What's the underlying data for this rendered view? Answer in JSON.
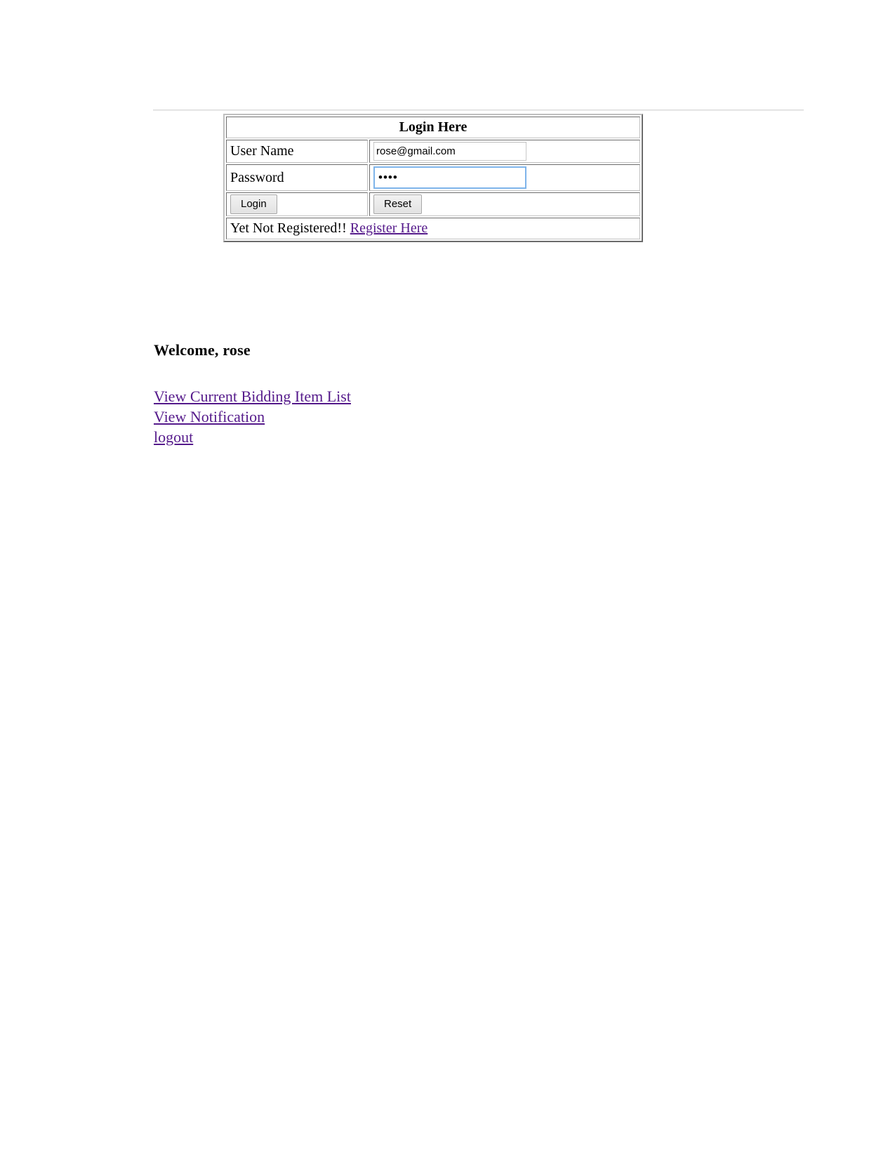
{
  "page": {
    "background_color": "#ffffff",
    "text_color": "#000000",
    "link_color": "#551a8b"
  },
  "divider": {
    "name": "horizontal-rule",
    "color": "#d9d9d9"
  },
  "login_form": {
    "title": "Login Here",
    "rows": {
      "username": {
        "label": "User Name",
        "value": "rose@gmail.com",
        "placeholder": "",
        "type": "text",
        "focused": false
      },
      "password": {
        "label": "Password",
        "value": "••••",
        "masked_value": "••••",
        "placeholder": "",
        "type": "password",
        "focused": true,
        "focus_ring_color": "#7eb4ea"
      }
    },
    "buttons": {
      "submit_label": "Login",
      "reset_label": "Reset"
    },
    "register": {
      "prompt": "Yet Not Registered!!",
      "link_label": "Register Here"
    }
  },
  "account": {
    "welcome_heading": "Welcome, rose",
    "username": "rose",
    "links": [
      {
        "label": "View Current Bidding Item List",
        "name": "view-current-bidding-item-list-link"
      },
      {
        "label": "View Notification",
        "name": "view-notification-link"
      },
      {
        "label": "logout",
        "name": "logout-link"
      }
    ]
  }
}
